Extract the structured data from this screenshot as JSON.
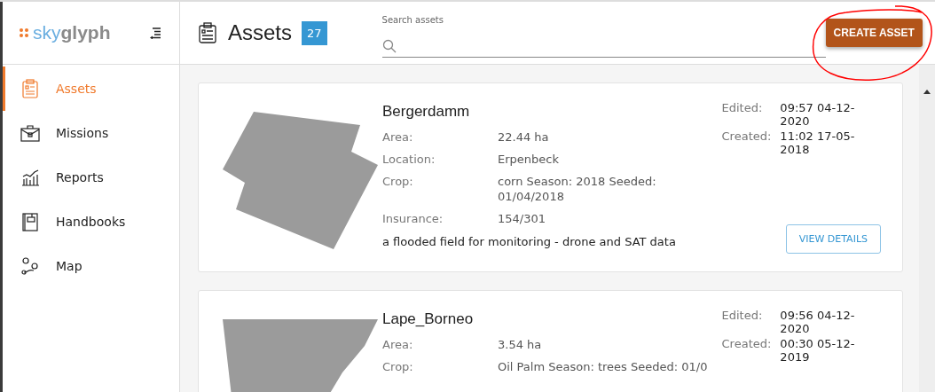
{
  "logo": {
    "prefix": "sky",
    "suffix": "glyph"
  },
  "sidebar": {
    "items": [
      {
        "label": "Assets",
        "selected": true
      },
      {
        "label": "Missions",
        "selected": false
      },
      {
        "label": "Reports",
        "selected": false
      },
      {
        "label": "Handbooks",
        "selected": false
      },
      {
        "label": "Map",
        "selected": false
      }
    ]
  },
  "header": {
    "title": "Assets",
    "count": "27",
    "search": {
      "label": "Search assets"
    },
    "create_button": "CREATE ASSET"
  },
  "assets": [
    {
      "name": "Bergerdamm",
      "fields": [
        {
          "label": "Area:",
          "value": "22.44 ha"
        },
        {
          "label": "Location:",
          "value": "Erpenbeck"
        },
        {
          "label": "Crop:",
          "value": "corn Season: 2018 Seeded: 01/04/2018"
        },
        {
          "label": "Insurance:",
          "value": "154/301"
        }
      ],
      "description": "a flooded field for monitoring - drone and SAT data",
      "edited": "09:57 04-12-2020",
      "created": "11:02 17-05-2018",
      "edited_label": "Edited:",
      "created_label": "Created:",
      "button": "VIEW DETAILS"
    },
    {
      "name": "Lape_Borneo",
      "fields": [
        {
          "label": "Area:",
          "value": "3.54 ha"
        },
        {
          "label": "Crop:",
          "value": "Oil Palm Season: trees Seeded: 01/0"
        }
      ],
      "edited": "09:56 04-12-2020",
      "created": "00:30 05-12-2019",
      "edited_label": "Edited:",
      "created_label": "Created:"
    }
  ]
}
